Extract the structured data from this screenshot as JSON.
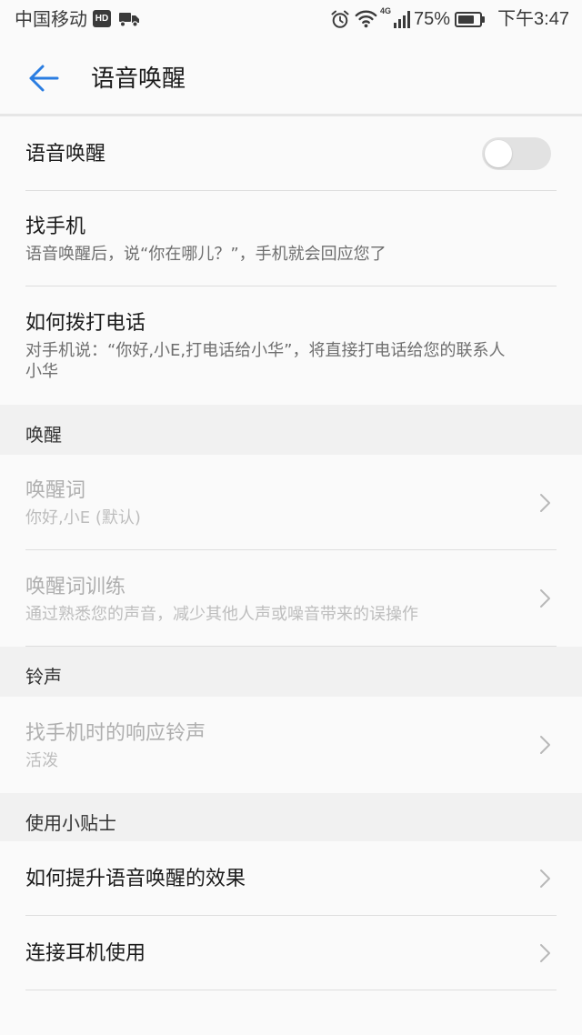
{
  "colors": {
    "accent": "#2a7de1",
    "page_background": "#fafafa",
    "section_header_background": "#f1f1f1",
    "section_header_text": "#333333",
    "title_text": "#1b1b1b",
    "subtitle_text": "#6e6e6e",
    "disabled_title_text": "#afafaf",
    "disabled_subtitle_text": "#bdbdbd",
    "divider": "#dedede",
    "toggle_track_off": "#e2e2e2",
    "chevron": "#b8b8b8",
    "status_bar_foreground": "#3a3a3a"
  },
  "icons": {
    "status_bar": [
      "hd-badge-icon",
      "truck-icon",
      "alarm-icon",
      "wifi-icon",
      "signal-icon",
      "battery-icon"
    ],
    "back": "arrow-left-icon",
    "row_action": "chevron-right-icon"
  },
  "status_bar": {
    "carrier": "中国移动",
    "hd_badge": "HD",
    "network_type": "4G",
    "battery_text": "75%",
    "battery_level": 0.75,
    "time": "下午3:47"
  },
  "app_bar": {
    "title": "语音唤醒"
  },
  "general": {
    "voice_wake": {
      "title": "语音唤醒",
      "toggle_on": false
    },
    "find_phone": {
      "title": "找手机",
      "subtitle": "语音唤醒后，说“你在哪儿？”，手机就会回应您了"
    },
    "how_to_call": {
      "title": "如何拨打电话",
      "subtitle": "对手机说：“你好,小E,打电话给小华”，将直接打电话给您的联系人小华"
    }
  },
  "wake_section": {
    "header": "唤醒",
    "items": [
      {
        "title": "唤醒词",
        "subtitle": "你好,小E (默认)",
        "enabled": false
      },
      {
        "title": "唤醒词训练",
        "subtitle": "通过熟悉您的声音，减少其他人声或噪音带来的误操作",
        "enabled": false
      }
    ]
  },
  "ringtone_section": {
    "header": "铃声",
    "items": [
      {
        "title": "找手机时的响应铃声",
        "subtitle": "活泼",
        "enabled": false
      }
    ]
  },
  "tips_section": {
    "header": "使用小贴士",
    "items": [
      {
        "title": "如何提升语音唤醒的效果",
        "enabled": true
      },
      {
        "title": "连接耳机使用",
        "enabled": true
      }
    ]
  }
}
